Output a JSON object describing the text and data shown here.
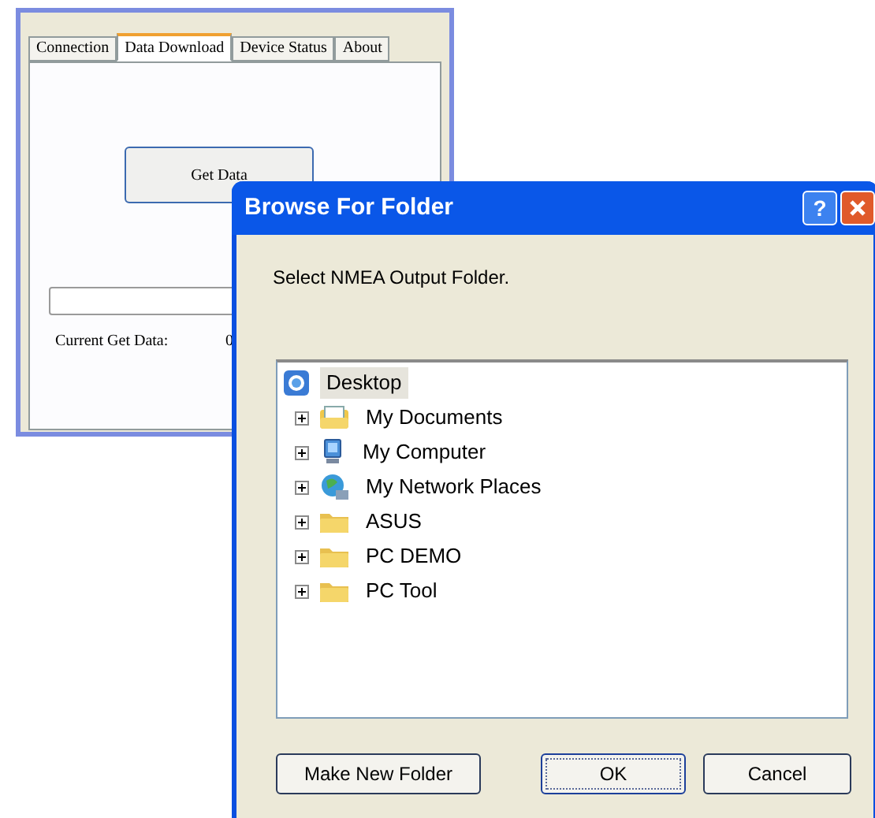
{
  "main_window": {
    "tabs": [
      {
        "label": "Connection",
        "selected": false
      },
      {
        "label": "Data Download",
        "selected": true
      },
      {
        "label": "Device Status",
        "selected": false
      },
      {
        "label": "About",
        "selected": false
      }
    ],
    "get_data_button": "Get Data",
    "progress": {
      "level": 0
    },
    "current_get_data_label": "Current Get Data:",
    "current_get_data_value": "0"
  },
  "dialog": {
    "title": "Browse For Folder",
    "help_button": "?",
    "prompt": "Select NMEA Output Folder.",
    "tree": {
      "label": "Desktop",
      "kind": "desktop",
      "selected": true,
      "children": [
        {
          "label": "My Documents",
          "kind": "documents",
          "selected": false,
          "expanded": false
        },
        {
          "label": "My Computer",
          "kind": "computer",
          "selected": false,
          "expanded": false
        },
        {
          "label": "My Network Places",
          "kind": "network",
          "selected": false,
          "expanded": false
        },
        {
          "label": "ASUS",
          "kind": "folder",
          "selected": false,
          "expanded": false
        },
        {
          "label": "PC DEMO",
          "kind": "folder",
          "selected": false,
          "expanded": false
        },
        {
          "label": "PC Tool",
          "kind": "folder",
          "selected": false,
          "expanded": false
        }
      ]
    },
    "buttons": [
      {
        "label": "Make New Folder",
        "default": false
      },
      {
        "label": "OK",
        "default": true
      },
      {
        "label": "Cancel",
        "default": false
      }
    ]
  }
}
